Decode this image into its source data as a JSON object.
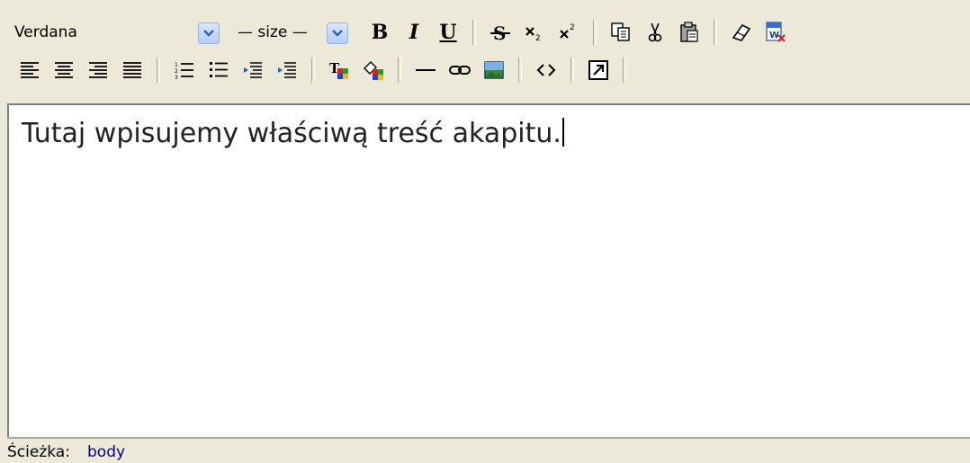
{
  "toolbar": {
    "font_select": {
      "value": "Verdana"
    },
    "size_select": {
      "value": "— size —"
    },
    "bold_label": "B",
    "italic_label": "I",
    "underline_label": "U"
  },
  "content": {
    "text": "Tutaj wpisujemy właściwą treść akapitu."
  },
  "statusbar": {
    "label": "Ścieżka:",
    "path": "body"
  },
  "colors": {
    "chrome": "#ece9d8",
    "dropdown_blue": "#b4cdf7",
    "path_link": "#00008b"
  }
}
